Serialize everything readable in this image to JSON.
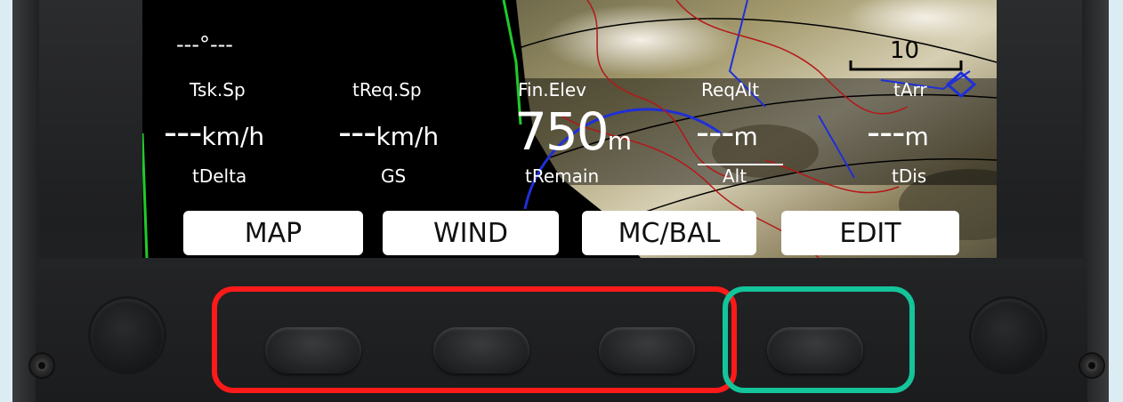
{
  "nav_bar": {
    "mc_value": "---°---",
    "scale_value": "10"
  },
  "fields": [
    {
      "label": "Tsk.Sp",
      "value": "---",
      "unit": "km/h"
    },
    {
      "label": "tReq.Sp",
      "value": "---",
      "unit": "km/h"
    },
    {
      "label": "Fin.Elev",
      "value": "750",
      "unit": "m"
    },
    {
      "label": "ReqAlt",
      "value": "---",
      "unit": "m"
    },
    {
      "label": "tArr",
      "value": "---",
      "unit": "m"
    },
    {
      "label": "tDelta"
    },
    {
      "label": "GS"
    },
    {
      "label": "tRemain"
    },
    {
      "label": "Alt"
    },
    {
      "label": "tDis"
    }
  ],
  "softkeys": [
    "MAP",
    "WIND",
    "MC/BAL",
    "EDIT"
  ],
  "colors": {
    "highlight_red": "#ff1a1a",
    "highlight_green": "#14c49a",
    "screen_bg": "#000000",
    "softkey_bg": "#ffffff"
  }
}
